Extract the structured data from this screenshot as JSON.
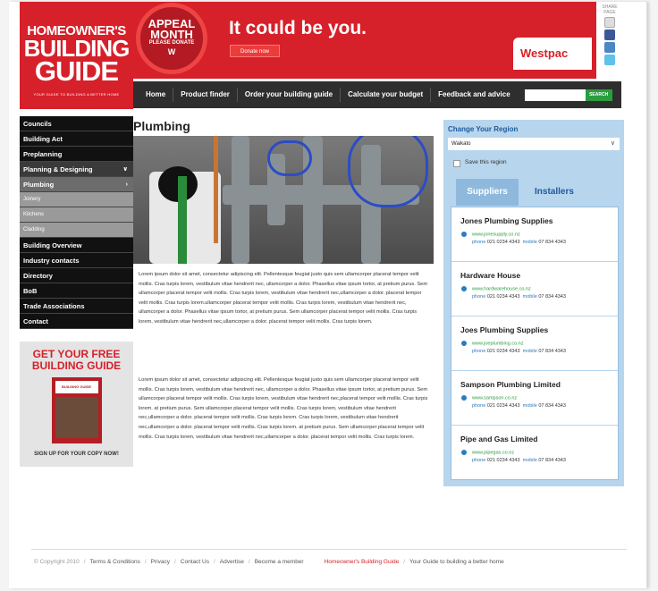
{
  "logo": {
    "line1": "HOMEOWNER'S",
    "line2": "BUILDING",
    "line3": "GUIDE",
    "tagline": "YOUR GUIDE TO BUILDING A BETTER HOME"
  },
  "banner": {
    "badge_line1": "APPEAL",
    "badge_line2": "MONTH",
    "badge_line3": "PLEASE DONATE",
    "badge_logo": "W",
    "headline": "It could be you.",
    "donate_label": "Donate now",
    "sponsor": "Westpac"
  },
  "share": {
    "title": "SHARE PAGE"
  },
  "nav": {
    "items": [
      "Home",
      "Product finder",
      "Order your building guide",
      "Calculate your budget",
      "Feedback and advice"
    ],
    "search_button": "SEARCH"
  },
  "sidebar": {
    "items": [
      "Councils",
      "Building Act",
      "Preplanning",
      "Planning & Designing",
      "Plumbing",
      "Joinery",
      "Kitchens",
      "Cladding",
      "Building Overview",
      "Industry contacts",
      "Directory",
      "BoB",
      "Trade Associations",
      "Contact"
    ]
  },
  "promo": {
    "title1": "GET YOUR FREE",
    "title2": "BUILDING GUIDE",
    "cover_title": "BUILDING GUIDE",
    "cta": "SIGN UP FOR YOUR COPY NOW!"
  },
  "main": {
    "title": "Plumbing",
    "para1": "Lorem ipsum dolor sit amet, consectetur adipiscing elit. Pellentesque feugiat justo quis sem ullamcorper placerat tempor velit mollis. Cras turpis lorem, vestibulum vitae hendrerit nec, ullamcorper a dolor. Phasellus vitae ipsum tortor, at pretium purus. Sem ullamcorper placerat tempor velit mollis. Cras turpis lorem, vestibulum vitae hendrerit nec,ullamcorper a dolor. placerat tempor velit mollis. Cras turpis lorem.ullamcorper placerat tempor velit mollis. Cras turpis lorem, vestibulum vitae hendrerit nec, ullamcorper a dolor. Phasellus vitae ipsum tortor, at pretium purus. Sem ullamcorper placerat tempor velit mollis. Cras turpis lorem, vestibulum vitae hendrerit nec,ullamcorper a dolor. placerat tempor velit mollis. Cras turpis lorem.",
    "para2": "Lorem ipsum dolor sit amet, consectetur adipiscing elit. Pellentesque feugiat justo quis sem ullamcorper placerat tempor velit mollis. Cras turpis lorem, vestibulum vitae hendrerit nec, ullamcorper a dolor. Phasellus vitae ipsum tortor, at pretium purus. Sem ullamcorper placerat tempor velit mollis. Cras turpis lorem, vestibulum vitae hendrerit nec,placerat tempor velit mollis. Cras turpis lorem. at pretium purus. Sem ullamcorper placerat tempor velit mollis. Cras turpis lorem, vestibulum vitae hendrerit nec,ullamcorper a dolor. placerat tempor velit mollis. Cras turpis lorem. Cras turpis lorem, vestibulum vitae hendrerit nec,ullamcorper a dolor. placerat tempor velit mollis. Cras turpis lorem. at pretium purus. Sem ullamcorper placerat tempor velit mollis. Cras turpis lorem, vestibulum vitae hendrerit nec,ullamcorper a dolor. placerat tempor velit mollis. Cras turpis lorem."
  },
  "region": {
    "title": "Change Your Region",
    "selected": "Waikato",
    "save_label": "Save this region",
    "tabs": [
      "Suppliers",
      "Installers"
    ],
    "phone_label": "phone",
    "mobile_label": "mobile",
    "suppliers": [
      {
        "name": "Jones Plumbing Supplies",
        "web": "www.jonesupply.co.nz",
        "phone": "021 0234 4343",
        "mobile": "07 834 4343"
      },
      {
        "name": "Hardware House",
        "web": "www.hardwarehouse.co.nz",
        "phone": "021 0234 4343",
        "mobile": "07 834 4343"
      },
      {
        "name": "Joes Plumbing Supplies",
        "web": "www.joeplumbing.co.nz",
        "phone": "021 0234 4343",
        "mobile": "07 834 4343"
      },
      {
        "name": "Sampson Plumbing Limited",
        "web": "www.sampson.co.nz",
        "phone": "021 0234 4343",
        "mobile": "07 834 4343"
      },
      {
        "name": "Pipe and Gas Limited",
        "web": "www.pipegas.co.nz",
        "phone": "021 0234 4343",
        "mobile": "07 834 4343"
      }
    ]
  },
  "footer": {
    "copyright": "© Copyright 2010",
    "links": [
      "Terms & Conditions",
      "Privacy",
      "Contact Us",
      "Advertise",
      "Become a member"
    ],
    "brand": "Homeowner's Building Guide",
    "slogan": "Your Guide to building a better home"
  }
}
